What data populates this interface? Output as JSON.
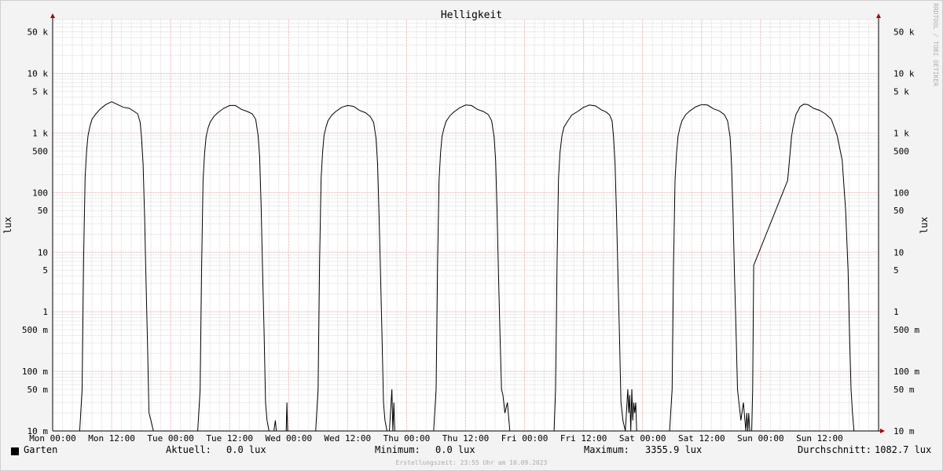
{
  "chart_data": {
    "type": "line",
    "title": "Helligkeit",
    "ylabel": "lux",
    "ylabel_right": "lux",
    "yscale": "log",
    "ylim": [
      0.01,
      80000
    ],
    "yticks": [
      {
        "value": 50000,
        "label": "50 k"
      },
      {
        "value": 10000,
        "label": "10 k"
      },
      {
        "value": 5000,
        "label": "5 k"
      },
      {
        "value": 1000,
        "label": "1 k"
      },
      {
        "value": 500,
        "label": "500"
      },
      {
        "value": 100,
        "label": "100"
      },
      {
        "value": 50,
        "label": "50"
      },
      {
        "value": 10,
        "label": "10"
      },
      {
        "value": 5,
        "label": "5"
      },
      {
        "value": 1,
        "label": "1"
      },
      {
        "value": 0.5,
        "label": "500 m"
      },
      {
        "value": 0.1,
        "label": "100 m"
      },
      {
        "value": 0.05,
        "label": "50 m"
      },
      {
        "value": 0.01,
        "label": "10 m"
      }
    ],
    "xlim_hours": [
      0,
      168
    ],
    "xticks": [
      {
        "hour": 0,
        "label": "Mon 00:00"
      },
      {
        "hour": 12,
        "label": "Mon 12:00"
      },
      {
        "hour": 24,
        "label": "Tue 00:00"
      },
      {
        "hour": 36,
        "label": "Tue 12:00"
      },
      {
        "hour": 48,
        "label": "Wed 00:00"
      },
      {
        "hour": 60,
        "label": "Wed 12:00"
      },
      {
        "hour": 72,
        "label": "Thu 00:00"
      },
      {
        "hour": 84,
        "label": "Thu 12:00"
      },
      {
        "hour": 96,
        "label": "Fri 00:00"
      },
      {
        "hour": 108,
        "label": "Fri 12:00"
      },
      {
        "hour": 120,
        "label": "Sat 00:00"
      },
      {
        "hour": 132,
        "label": "Sat 12:00"
      },
      {
        "hour": 144,
        "label": "Sun 00:00"
      },
      {
        "hour": 156,
        "label": "Sun 12:00"
      }
    ],
    "grid": true,
    "series": [
      {
        "name": "Garten",
        "color": "#000000",
        "x_hours": [
          0,
          5.5,
          6.0,
          6.3,
          6.6,
          6.9,
          7.2,
          7.6,
          8.0,
          8.8,
          9.6,
          10.8,
          12.0,
          13.2,
          14.4,
          15.6,
          16.6,
          17.3,
          17.8,
          18.1,
          18.4,
          18.7,
          19.0,
          19.3,
          19.6,
          20.0,
          20.5,
          21.0,
          29.5,
          30.0,
          30.3,
          30.6,
          30.9,
          31.2,
          31.6,
          32.0,
          32.8,
          33.6,
          34.8,
          36.0,
          37.2,
          38.4,
          39.6,
          40.6,
          41.3,
          41.8,
          42.1,
          42.4,
          42.7,
          43.0,
          43.3,
          43.6,
          44.0,
          44.5,
          45.0,
          45.3,
          45.5,
          47.5,
          47.65,
          47.8,
          53.5,
          54.0,
          54.3,
          54.6,
          54.9,
          55.2,
          55.6,
          56.0,
          56.8,
          57.6,
          58.8,
          60.0,
          61.2,
          62.4,
          63.6,
          64.6,
          65.3,
          65.8,
          66.1,
          66.4,
          66.7,
          67.0,
          67.3,
          67.6,
          68.0,
          68.5,
          69.0,
          69.2,
          69.4,
          69.6,
          69.8,
          70.0,
          77.5,
          78.0,
          78.3,
          78.6,
          78.9,
          79.2,
          79.6,
          80.0,
          80.8,
          81.6,
          82.8,
          84.0,
          85.2,
          86.4,
          87.6,
          88.6,
          89.3,
          89.8,
          90.1,
          90.4,
          90.7,
          91.0,
          91.3,
          91.6,
          92.0,
          92.5,
          93.0,
          93.2,
          93.4,
          101.5,
          102.0,
          102.3,
          102.6,
          102.9,
          103.2,
          103.6,
          104.0,
          104.8,
          105.6,
          106.8,
          108.0,
          109.2,
          110.4,
          111.6,
          112.6,
          113.3,
          113.8,
          114.1,
          114.4,
          114.7,
          115.0,
          115.3,
          115.6,
          116.0,
          116.5,
          117.0,
          117.2,
          117.4,
          117.6,
          117.8,
          118.0,
          118.2,
          118.4,
          118.6,
          118.8,
          119.0,
          119.2,
          119.4,
          125.5,
          126.0,
          126.3,
          126.6,
          126.9,
          127.2,
          127.6,
          128.0,
          128.8,
          129.6,
          130.8,
          132.0,
          133.2,
          134.4,
          135.6,
          136.6,
          137.3,
          137.8,
          138.1,
          138.4,
          138.7,
          139.0,
          139.3,
          139.6,
          140.0,
          140.5,
          141.0,
          141.2,
          141.4,
          141.6,
          141.8,
          142.0,
          142.2,
          142.4,
          142.6,
          149.5,
          150.0,
          150.3,
          150.6,
          150.9,
          151.2,
          151.6,
          152.0,
          152.8,
          153.6,
          154.8,
          156.0,
          157.2,
          158.4,
          159.6,
          160.6,
          161.3,
          161.8,
          162.1,
          162.4,
          162.7,
          163.0,
          163.3,
          163.6,
          164.0,
          164.5,
          165.0,
          168
        ],
        "y_lux": [
          0.01,
          0.01,
          0.05,
          8,
          180,
          500,
          900,
          1300,
          1700,
          2100,
          2500,
          3000,
          3355.9,
          3000,
          2700,
          2600,
          2300,
          2100,
          1500,
          800,
          300,
          40,
          3,
          0.3,
          0.02,
          0.015,
          0.01,
          0.01,
          0.01,
          0.05,
          6,
          160,
          450,
          850,
          1200,
          1500,
          1900,
          2200,
          2600,
          2900,
          2900,
          2500,
          2300,
          2100,
          1700,
          900,
          400,
          60,
          5,
          0.5,
          0.03,
          0.015,
          0.01,
          0.01,
          0.01,
          0.015,
          0.01,
          0.01,
          0.03,
          0.01,
          0.01,
          0.05,
          7,
          170,
          470,
          900,
          1250,
          1600,
          2000,
          2300,
          2700,
          2900,
          2800,
          2400,
          2200,
          1900,
          1500,
          800,
          300,
          40,
          4,
          0.4,
          0.03,
          0.015,
          0.01,
          0.01,
          0.05,
          0.01,
          0.03,
          0.01,
          0.01,
          0.01,
          0.01,
          0.05,
          6,
          160,
          460,
          880,
          1200,
          1550,
          1950,
          2250,
          2650,
          2950,
          2900,
          2500,
          2300,
          2050,
          1600,
          850,
          350,
          50,
          4,
          0.4,
          0.05,
          0.04,
          0.02,
          0.03,
          0.01,
          0.01,
          0.01,
          0.01,
          0.01,
          0.05,
          7,
          170,
          470,
          900,
          1250,
          1600,
          2000,
          2300,
          2700,
          2950,
          2850,
          2450,
          2250,
          2000,
          1600,
          850,
          300,
          40,
          4,
          0.4,
          0.03,
          0.015,
          0.01,
          0.05,
          0.02,
          0.04,
          0.01,
          0.05,
          0.015,
          0.03,
          0.02,
          0.03,
          0.01,
          0.01,
          0.01,
          0.01,
          0.01,
          0.05,
          6,
          160,
          460,
          880,
          1250,
          1600,
          2050,
          2350,
          2750,
          3000,
          2950,
          2550,
          2350,
          2050,
          1600,
          850,
          300,
          45,
          4,
          0.5,
          0.05,
          0.03,
          0.015,
          0.03,
          0.01,
          0.02,
          0.01,
          0.02,
          0.01,
          0.01,
          0.01,
          0.05,
          6,
          160,
          460,
          880,
          1250,
          1600,
          2050,
          2350,
          2750,
          3050,
          3000,
          2600,
          2400,
          2100,
          1700,
          900,
          350,
          50,
          5,
          0.4,
          0.05,
          0.02,
          0.01,
          0.01,
          0.01,
          0.01
        ]
      }
    ]
  },
  "legend": {
    "series_name": "Garten",
    "current_label": "Aktuell:",
    "current_value": "0.0 lux",
    "min_label": "Minimum:",
    "min_value": "0.0 lux",
    "max_label": "Maximum:",
    "max_value": "3355.9 lux",
    "avg_label": "Durchschnitt:",
    "avg_value": "1082.7 lux"
  },
  "footer": "Erstellungszeit: 23:55 Uhr am 10.09.2023",
  "watermark": "RRDTOOL / TOBI OETIKER",
  "colors": {
    "background": "#f3f3f3",
    "plot_background": "#ffffff",
    "major_grid": "#e8a0a0",
    "minor_grid": "#d8d8d8",
    "line": "#000000",
    "axis_arrow": "#aa0000"
  }
}
